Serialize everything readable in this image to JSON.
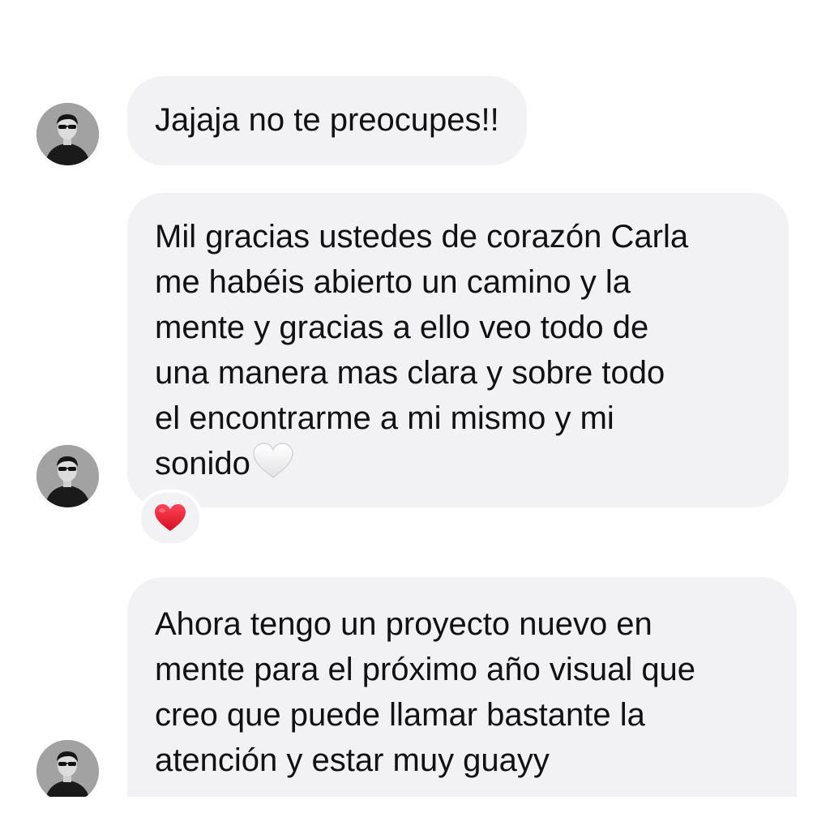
{
  "messages": [
    {
      "lines": [
        "Jajaja no te preocupes!!"
      ]
    },
    {
      "lines": [
        "Mil gracias ustedes de corazón Carla",
        "me habéis abierto un camino y la",
        "mente y gracias a ello veo todo de",
        "una manera mas clara y sobre todo",
        "el encontrarme a mi mismo y mi",
        "sonido"
      ],
      "trailing_emoji": "white-heart-icon",
      "reaction": "red-heart-icon"
    },
    {
      "lines": [
        "Ahora tengo un proyecto nuevo en",
        "mente para el próximo año visual que",
        "creo que puede llamar bastante la",
        "atención y estar muy guayy"
      ]
    }
  ],
  "colors": {
    "bubble_background": "#f2f2f4",
    "text": "#111111",
    "reaction_heart": "#e0142a",
    "page_background": "#ffffff"
  }
}
